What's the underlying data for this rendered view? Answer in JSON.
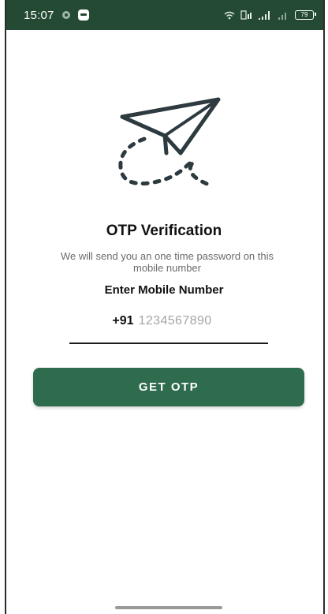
{
  "status_bar": {
    "time": "15:07",
    "signal_text": "…ıl",
    "battery": "79"
  },
  "content": {
    "title": "OTP Verification",
    "subtitle": "We will send you an one time password on this mobile number",
    "mobile_label": "Enter Mobile Number",
    "country_code": "+91",
    "phone_placeholder": "1234567890",
    "phone_value": "",
    "get_otp_label": "GET OTP"
  },
  "icons": {
    "illustration": "paper-plane-icon"
  },
  "colors": {
    "status_bar": "#244a34",
    "button": "#2f6b4d",
    "plane_accent": "#4cc0e6"
  }
}
